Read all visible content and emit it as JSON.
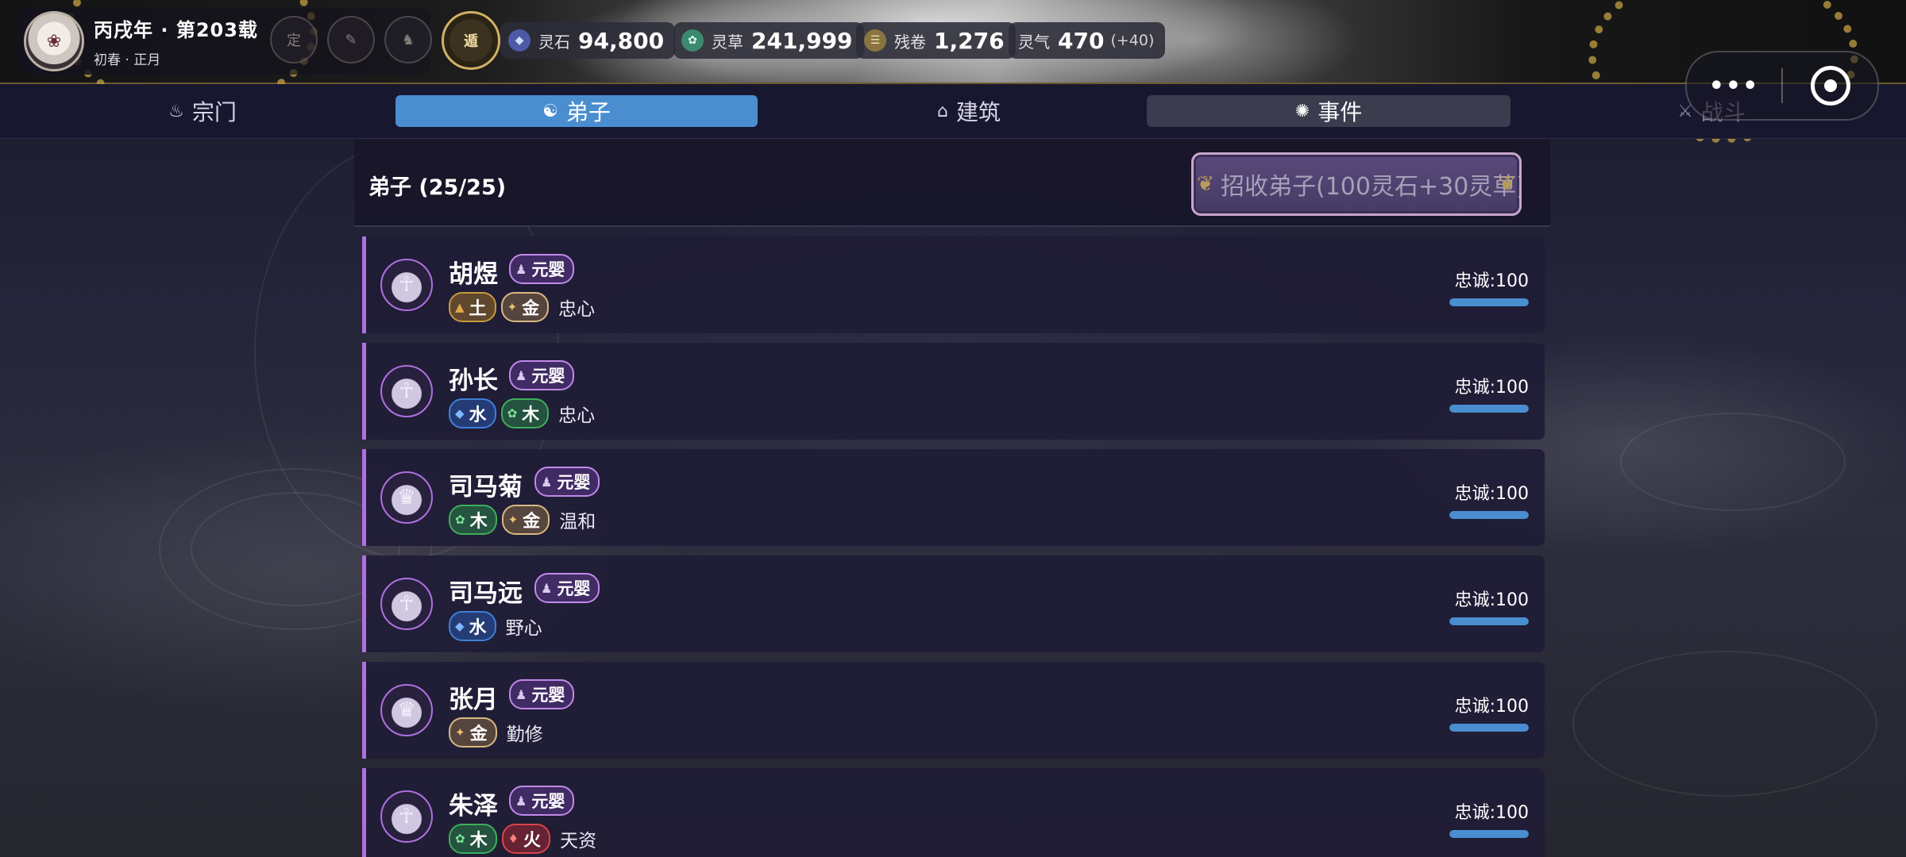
{
  "player": {
    "title": "丙戌年 · 第203载",
    "season": "初春 · 正月"
  },
  "tools": [
    {
      "label": "定",
      "icon": "seal-icon"
    },
    {
      "label": "",
      "icon": "brush-icon"
    },
    {
      "label": "",
      "icon": "beast-icon"
    },
    {
      "label": "遁",
      "icon": "escape-icon"
    }
  ],
  "resources": {
    "spirit_stone": {
      "label": "灵石",
      "value": "94,800",
      "icon": "spirit-stone-icon"
    },
    "spirit_herb": {
      "label": "灵草",
      "value": "241,999",
      "icon": "spirit-herb-icon"
    },
    "fragment": {
      "label": "残卷",
      "value": "1,276",
      "icon": "scroll-icon"
    },
    "qi": {
      "label": "灵气",
      "value": "470",
      "delta": "(+40)"
    }
  },
  "capsule": {
    "more": "•••"
  },
  "nav": {
    "tabs": [
      {
        "label": "宗门",
        "icon": "sect-icon"
      },
      {
        "label": "弟子",
        "icon": "disciple-icon"
      },
      {
        "label": "建筑",
        "icon": "building-icon"
      },
      {
        "label": "事件",
        "icon": "event-icon"
      },
      {
        "label": "战斗",
        "icon": "battle-icon"
      }
    ],
    "selected": "弟子"
  },
  "panel": {
    "title": "弟子 (25/25)",
    "recruit_label": "招收弟子(100灵石+30灵草)"
  },
  "colors": {
    "accent_blue": "#4a8ed0",
    "realm_purple": "#b070e0",
    "element_earth": "#c79a3c",
    "element_metal": "#d8b880",
    "element_water": "#3f7fd8",
    "element_wood": "#3fae5a",
    "element_fire": "#d8454a"
  },
  "disciples": [
    {
      "name": "胡煜",
      "realm": "元婴",
      "elements": [
        "土",
        "金"
      ],
      "trait": "忠心",
      "loyalty_label": "忠诚:100",
      "loyalty": 100
    },
    {
      "name": "孙长",
      "realm": "元婴",
      "elements": [
        "水",
        "木"
      ],
      "trait": "忠心",
      "loyalty_label": "忠诚:100",
      "loyalty": 100
    },
    {
      "name": "司马菊",
      "realm": "元婴",
      "elements": [
        "木",
        "金"
      ],
      "trait": "温和",
      "loyalty_label": "忠诚:100",
      "loyalty": 100
    },
    {
      "name": "司马远",
      "realm": "元婴",
      "elements": [
        "水"
      ],
      "trait": "野心",
      "loyalty_label": "忠诚:100",
      "loyalty": 100
    },
    {
      "name": "张月",
      "realm": "元婴",
      "elements": [
        "金"
      ],
      "trait": "勤修",
      "loyalty_label": "忠诚:100",
      "loyalty": 100
    },
    {
      "name": "朱泽",
      "realm": "元婴",
      "elements": [
        "木",
        "火"
      ],
      "trait": "天资",
      "loyalty_label": "忠诚:100",
      "loyalty": 100
    }
  ]
}
